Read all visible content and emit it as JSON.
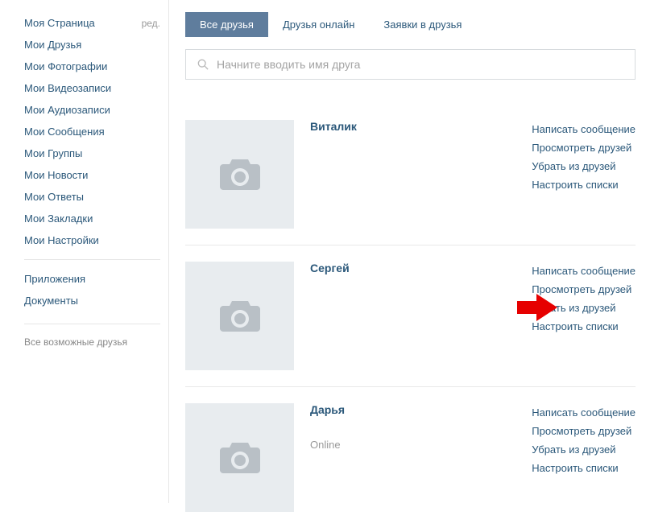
{
  "sidebar": {
    "items": [
      {
        "label": "Моя Страница",
        "edit": "ред."
      },
      {
        "label": "Мои Друзья"
      },
      {
        "label": "Мои Фотографии"
      },
      {
        "label": "Мои Видеозаписи"
      },
      {
        "label": "Мои Аудиозаписи"
      },
      {
        "label": "Мои Сообщения"
      },
      {
        "label": "Мои Группы"
      },
      {
        "label": "Мои Новости"
      },
      {
        "label": "Мои Ответы"
      },
      {
        "label": "Мои Закладки"
      },
      {
        "label": "Мои Настройки"
      }
    ],
    "section2": [
      {
        "label": "Приложения"
      },
      {
        "label": "Документы"
      }
    ],
    "suggest": "Все возможные друзья"
  },
  "tabs": {
    "all": "Все друзья",
    "online": "Друзья онлайн",
    "requests": "Заявки в друзья"
  },
  "search": {
    "placeholder": "Начните вводить имя друга"
  },
  "actions": {
    "message": "Написать сообщение",
    "view_friends": "Просмотреть друзей",
    "remove": "Убрать из друзей",
    "lists": "Настроить списки"
  },
  "friends": [
    {
      "name": "Виталик",
      "status": ""
    },
    {
      "name": "Сергей",
      "status": "",
      "arrow": true
    },
    {
      "name": "Дарья",
      "status": "Online"
    }
  ]
}
